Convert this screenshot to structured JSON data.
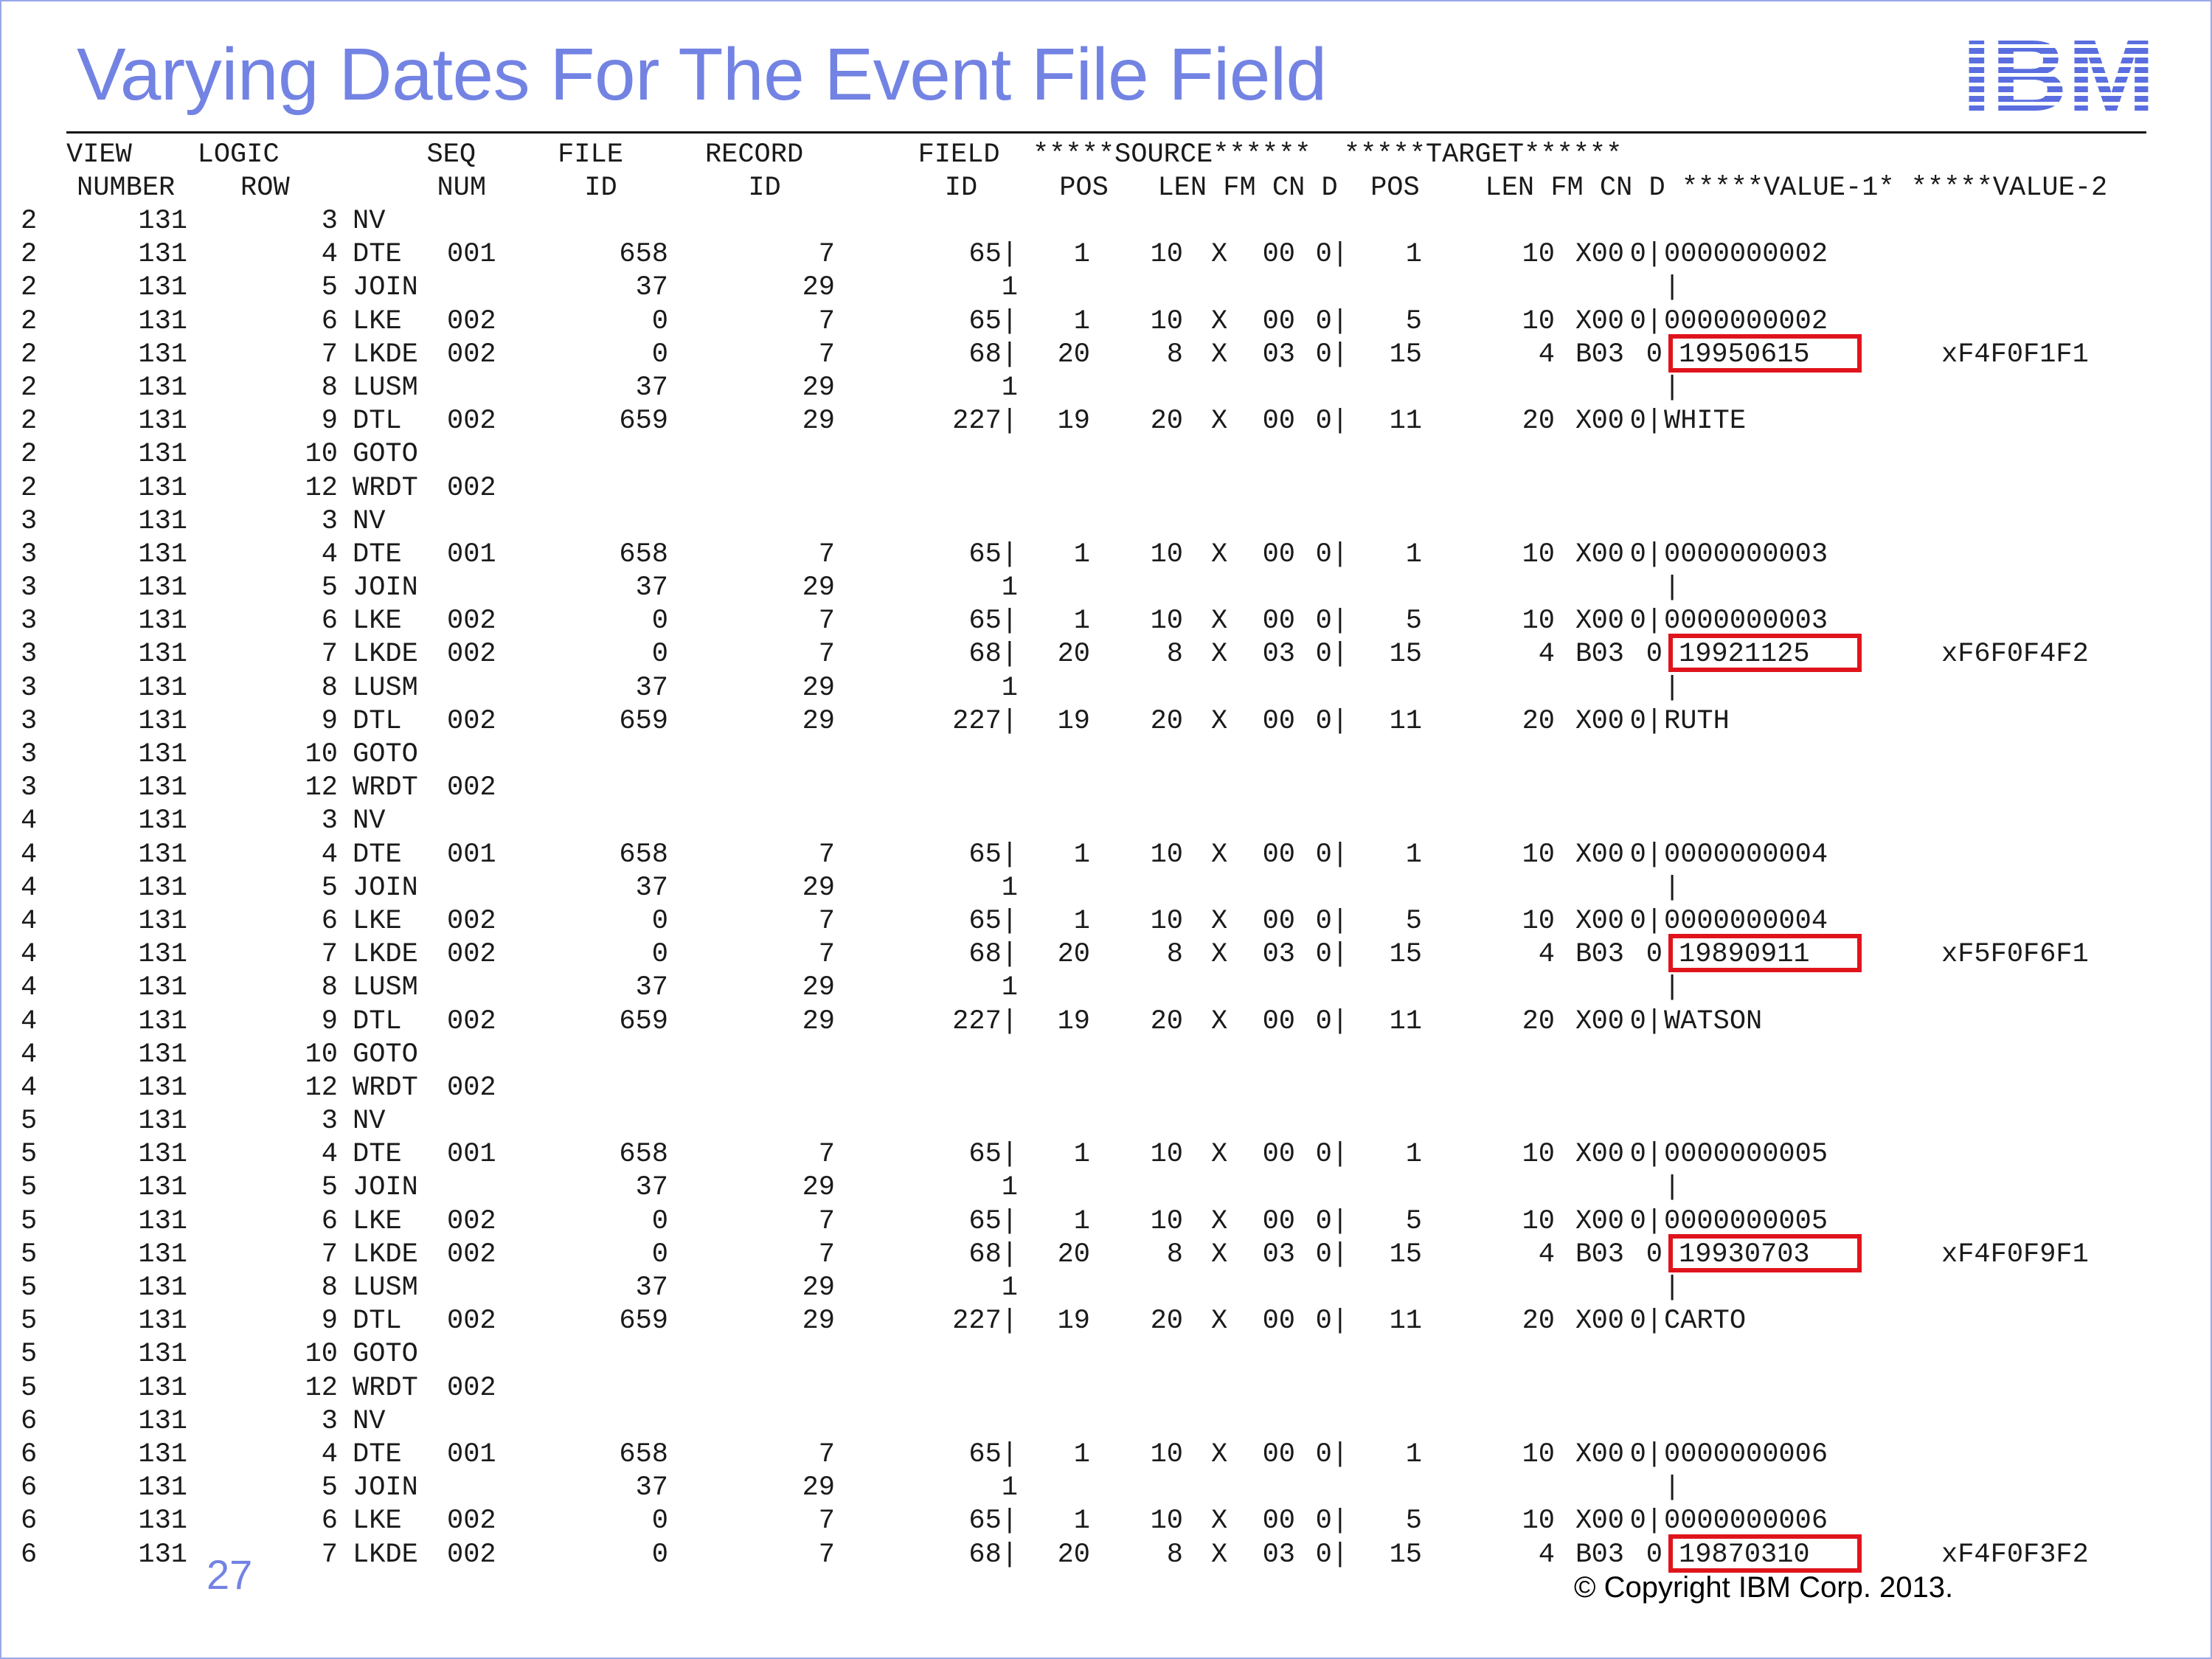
{
  "slide": {
    "title": "Varying Dates For The Event File Field",
    "page_number": "27",
    "copyright": "© Copyright IBM Corp. 2013.",
    "logo_text": "IBM",
    "accent_color": "#7383e3",
    "highlight_color": "#e0141c"
  },
  "header": {
    "line1": "VIEW    LOGIC         SEQ     FILE     RECORD       FIELD  *****SOURCE******  *****TARGET******",
    "line2": "NUMBER    ROW         NUM      ID        ID          ID     POS   LEN FM CN D  POS    LEN FM CN D *****VALUE-1* *****VALUE-2"
  },
  "rows": [
    [
      "2",
      "131",
      "3",
      "NV",
      "",
      "",
      "",
      "",
      "",
      "",
      "",
      "",
      "",
      "",
      "",
      "",
      "",
      "",
      "",
      "",
      ""
    ],
    [
      "2",
      "131",
      "4",
      "DTE",
      "001",
      "658",
      "7",
      "65|",
      "1",
      "10",
      "X",
      "00",
      "0|",
      "1",
      "10",
      "X",
      "00",
      "0|",
      "0000000002",
      "",
      ""
    ],
    [
      "2",
      "131",
      "5",
      "JOIN",
      "",
      "37",
      "29",
      "1",
      "",
      "",
      "",
      "",
      "",
      "",
      "",
      "",
      "",
      "",
      "|",
      "",
      ""
    ],
    [
      "2",
      "131",
      "6",
      "LKE",
      "002",
      "0",
      "7",
      "65|",
      "1",
      "10",
      "X",
      "00",
      "0|",
      "5",
      "10",
      "X",
      "00",
      "0|",
      "0000000002",
      "",
      ""
    ],
    [
      "2",
      "131",
      "7",
      "LKDE",
      "002",
      "0",
      "7",
      "68|",
      "20",
      "8",
      "X",
      "03",
      "0|",
      "15",
      "4",
      "B",
      "03",
      "0",
      "19950615",
      "xF4F0F1F1",
      "box"
    ],
    [
      "2",
      "131",
      "8",
      "LUSM",
      "",
      "37",
      "29",
      "1",
      "",
      "",
      "",
      "",
      "",
      "",
      "",
      "",
      "",
      "",
      "|",
      "",
      ""
    ],
    [
      "2",
      "131",
      "9",
      "DTL",
      "002",
      "659",
      "29",
      "227|",
      "19",
      "20",
      "X",
      "00",
      "0|",
      "11",
      "20",
      "X",
      "00",
      "0|",
      "WHITE",
      "",
      ""
    ],
    [
      "2",
      "131",
      "10",
      "GOTO",
      "",
      "",
      "",
      "",
      "",
      "",
      "",
      "",
      "",
      "",
      "",
      "",
      "",
      "",
      "",
      "",
      ""
    ],
    [
      "2",
      "131",
      "12",
      "WRDT",
      "002",
      "",
      "",
      "",
      "",
      "",
      "",
      "",
      "",
      "",
      "",
      "",
      "",
      "",
      "",
      "",
      ""
    ],
    [
      "3",
      "131",
      "3",
      "NV",
      "",
      "",
      "",
      "",
      "",
      "",
      "",
      "",
      "",
      "",
      "",
      "",
      "",
      "",
      "",
      "",
      ""
    ],
    [
      "3",
      "131",
      "4",
      "DTE",
      "001",
      "658",
      "7",
      "65|",
      "1",
      "10",
      "X",
      "00",
      "0|",
      "1",
      "10",
      "X",
      "00",
      "0|",
      "0000000003",
      "",
      ""
    ],
    [
      "3",
      "131",
      "5",
      "JOIN",
      "",
      "37",
      "29",
      "1",
      "",
      "",
      "",
      "",
      "",
      "",
      "",
      "",
      "",
      "",
      "|",
      "",
      ""
    ],
    [
      "3",
      "131",
      "6",
      "LKE",
      "002",
      "0",
      "7",
      "65|",
      "1",
      "10",
      "X",
      "00",
      "0|",
      "5",
      "10",
      "X",
      "00",
      "0|",
      "0000000003",
      "",
      ""
    ],
    [
      "3",
      "131",
      "7",
      "LKDE",
      "002",
      "0",
      "7",
      "68|",
      "20",
      "8",
      "X",
      "03",
      "0|",
      "15",
      "4",
      "B",
      "03",
      "0",
      "19921125",
      "xF6F0F4F2",
      "box"
    ],
    [
      "3",
      "131",
      "8",
      "LUSM",
      "",
      "37",
      "29",
      "1",
      "",
      "",
      "",
      "",
      "",
      "",
      "",
      "",
      "",
      "",
      "|",
      "",
      ""
    ],
    [
      "3",
      "131",
      "9",
      "DTL",
      "002",
      "659",
      "29",
      "227|",
      "19",
      "20",
      "X",
      "00",
      "0|",
      "11",
      "20",
      "X",
      "00",
      "0|",
      "RUTH",
      "",
      ""
    ],
    [
      "3",
      "131",
      "10",
      "GOTO",
      "",
      "",
      "",
      "",
      "",
      "",
      "",
      "",
      "",
      "",
      "",
      "",
      "",
      "",
      "",
      "",
      ""
    ],
    [
      "3",
      "131",
      "12",
      "WRDT",
      "002",
      "",
      "",
      "",
      "",
      "",
      "",
      "",
      "",
      "",
      "",
      "",
      "",
      "",
      "",
      "",
      ""
    ],
    [
      "4",
      "131",
      "3",
      "NV",
      "",
      "",
      "",
      "",
      "",
      "",
      "",
      "",
      "",
      "",
      "",
      "",
      "",
      "",
      "",
      "",
      ""
    ],
    [
      "4",
      "131",
      "4",
      "DTE",
      "001",
      "658",
      "7",
      "65|",
      "1",
      "10",
      "X",
      "00",
      "0|",
      "1",
      "10",
      "X",
      "00",
      "0|",
      "0000000004",
      "",
      ""
    ],
    [
      "4",
      "131",
      "5",
      "JOIN",
      "",
      "37",
      "29",
      "1",
      "",
      "",
      "",
      "",
      "",
      "",
      "",
      "",
      "",
      "",
      "|",
      "",
      ""
    ],
    [
      "4",
      "131",
      "6",
      "LKE",
      "002",
      "0",
      "7",
      "65|",
      "1",
      "10",
      "X",
      "00",
      "0|",
      "5",
      "10",
      "X",
      "00",
      "0|",
      "0000000004",
      "",
      ""
    ],
    [
      "4",
      "131",
      "7",
      "LKDE",
      "002",
      "0",
      "7",
      "68|",
      "20",
      "8",
      "X",
      "03",
      "0|",
      "15",
      "4",
      "B",
      "03",
      "0",
      "19890911",
      "xF5F0F6F1",
      "box"
    ],
    [
      "4",
      "131",
      "8",
      "LUSM",
      "",
      "37",
      "29",
      "1",
      "",
      "",
      "",
      "",
      "",
      "",
      "",
      "",
      "",
      "",
      "|",
      "",
      ""
    ],
    [
      "4",
      "131",
      "9",
      "DTL",
      "002",
      "659",
      "29",
      "227|",
      "19",
      "20",
      "X",
      "00",
      "0|",
      "11",
      "20",
      "X",
      "00",
      "0|",
      "WATSON",
      "",
      ""
    ],
    [
      "4",
      "131",
      "10",
      "GOTO",
      "",
      "",
      "",
      "",
      "",
      "",
      "",
      "",
      "",
      "",
      "",
      "",
      "",
      "",
      "",
      "",
      ""
    ],
    [
      "4",
      "131",
      "12",
      "WRDT",
      "002",
      "",
      "",
      "",
      "",
      "",
      "",
      "",
      "",
      "",
      "",
      "",
      "",
      "",
      "",
      "",
      ""
    ],
    [
      "5",
      "131",
      "3",
      "NV",
      "",
      "",
      "",
      "",
      "",
      "",
      "",
      "",
      "",
      "",
      "",
      "",
      "",
      "",
      "",
      "",
      ""
    ],
    [
      "5",
      "131",
      "4",
      "DTE",
      "001",
      "658",
      "7",
      "65|",
      "1",
      "10",
      "X",
      "00",
      "0|",
      "1",
      "10",
      "X",
      "00",
      "0|",
      "0000000005",
      "",
      ""
    ],
    [
      "5",
      "131",
      "5",
      "JOIN",
      "",
      "37",
      "29",
      "1",
      "",
      "",
      "",
      "",
      "",
      "",
      "",
      "",
      "",
      "",
      "|",
      "",
      ""
    ],
    [
      "5",
      "131",
      "6",
      "LKE",
      "002",
      "0",
      "7",
      "65|",
      "1",
      "10",
      "X",
      "00",
      "0|",
      "5",
      "10",
      "X",
      "00",
      "0|",
      "0000000005",
      "",
      ""
    ],
    [
      "5",
      "131",
      "7",
      "LKDE",
      "002",
      "0",
      "7",
      "68|",
      "20",
      "8",
      "X",
      "03",
      "0|",
      "15",
      "4",
      "B",
      "03",
      "0",
      "19930703",
      "xF4F0F9F1",
      "box"
    ],
    [
      "5",
      "131",
      "8",
      "LUSM",
      "",
      "37",
      "29",
      "1",
      "",
      "",
      "",
      "",
      "",
      "",
      "",
      "",
      "",
      "",
      "|",
      "",
      ""
    ],
    [
      "5",
      "131",
      "9",
      "DTL",
      "002",
      "659",
      "29",
      "227|",
      "19",
      "20",
      "X",
      "00",
      "0|",
      "11",
      "20",
      "X",
      "00",
      "0|",
      "CARTO",
      "",
      ""
    ],
    [
      "5",
      "131",
      "10",
      "GOTO",
      "",
      "",
      "",
      "",
      "",
      "",
      "",
      "",
      "",
      "",
      "",
      "",
      "",
      "",
      "",
      "",
      ""
    ],
    [
      "5",
      "131",
      "12",
      "WRDT",
      "002",
      "",
      "",
      "",
      "",
      "",
      "",
      "",
      "",
      "",
      "",
      "",
      "",
      "",
      "",
      "",
      ""
    ],
    [
      "6",
      "131",
      "3",
      "NV",
      "",
      "",
      "",
      "",
      "",
      "",
      "",
      "",
      "",
      "",
      "",
      "",
      "",
      "",
      "",
      "",
      ""
    ],
    [
      "6",
      "131",
      "4",
      "DTE",
      "001",
      "658",
      "7",
      "65|",
      "1",
      "10",
      "X",
      "00",
      "0|",
      "1",
      "10",
      "X",
      "00",
      "0|",
      "0000000006",
      "",
      ""
    ],
    [
      "6",
      "131",
      "5",
      "JOIN",
      "",
      "37",
      "29",
      "1",
      "",
      "",
      "",
      "",
      "",
      "",
      "",
      "",
      "",
      "",
      "|",
      "",
      ""
    ],
    [
      "6",
      "131",
      "6",
      "LKE",
      "002",
      "0",
      "7",
      "65|",
      "1",
      "10",
      "X",
      "00",
      "0|",
      "5",
      "10",
      "X",
      "00",
      "0|",
      "0000000006",
      "",
      ""
    ],
    [
      "6",
      "131",
      "7",
      "LKDE",
      "002",
      "0",
      "7",
      "68|",
      "20",
      "8",
      "X",
      "03",
      "0|",
      "15",
      "4",
      "B",
      "03",
      "0",
      "19870310",
      "xF4F0F3F2",
      "box"
    ]
  ]
}
